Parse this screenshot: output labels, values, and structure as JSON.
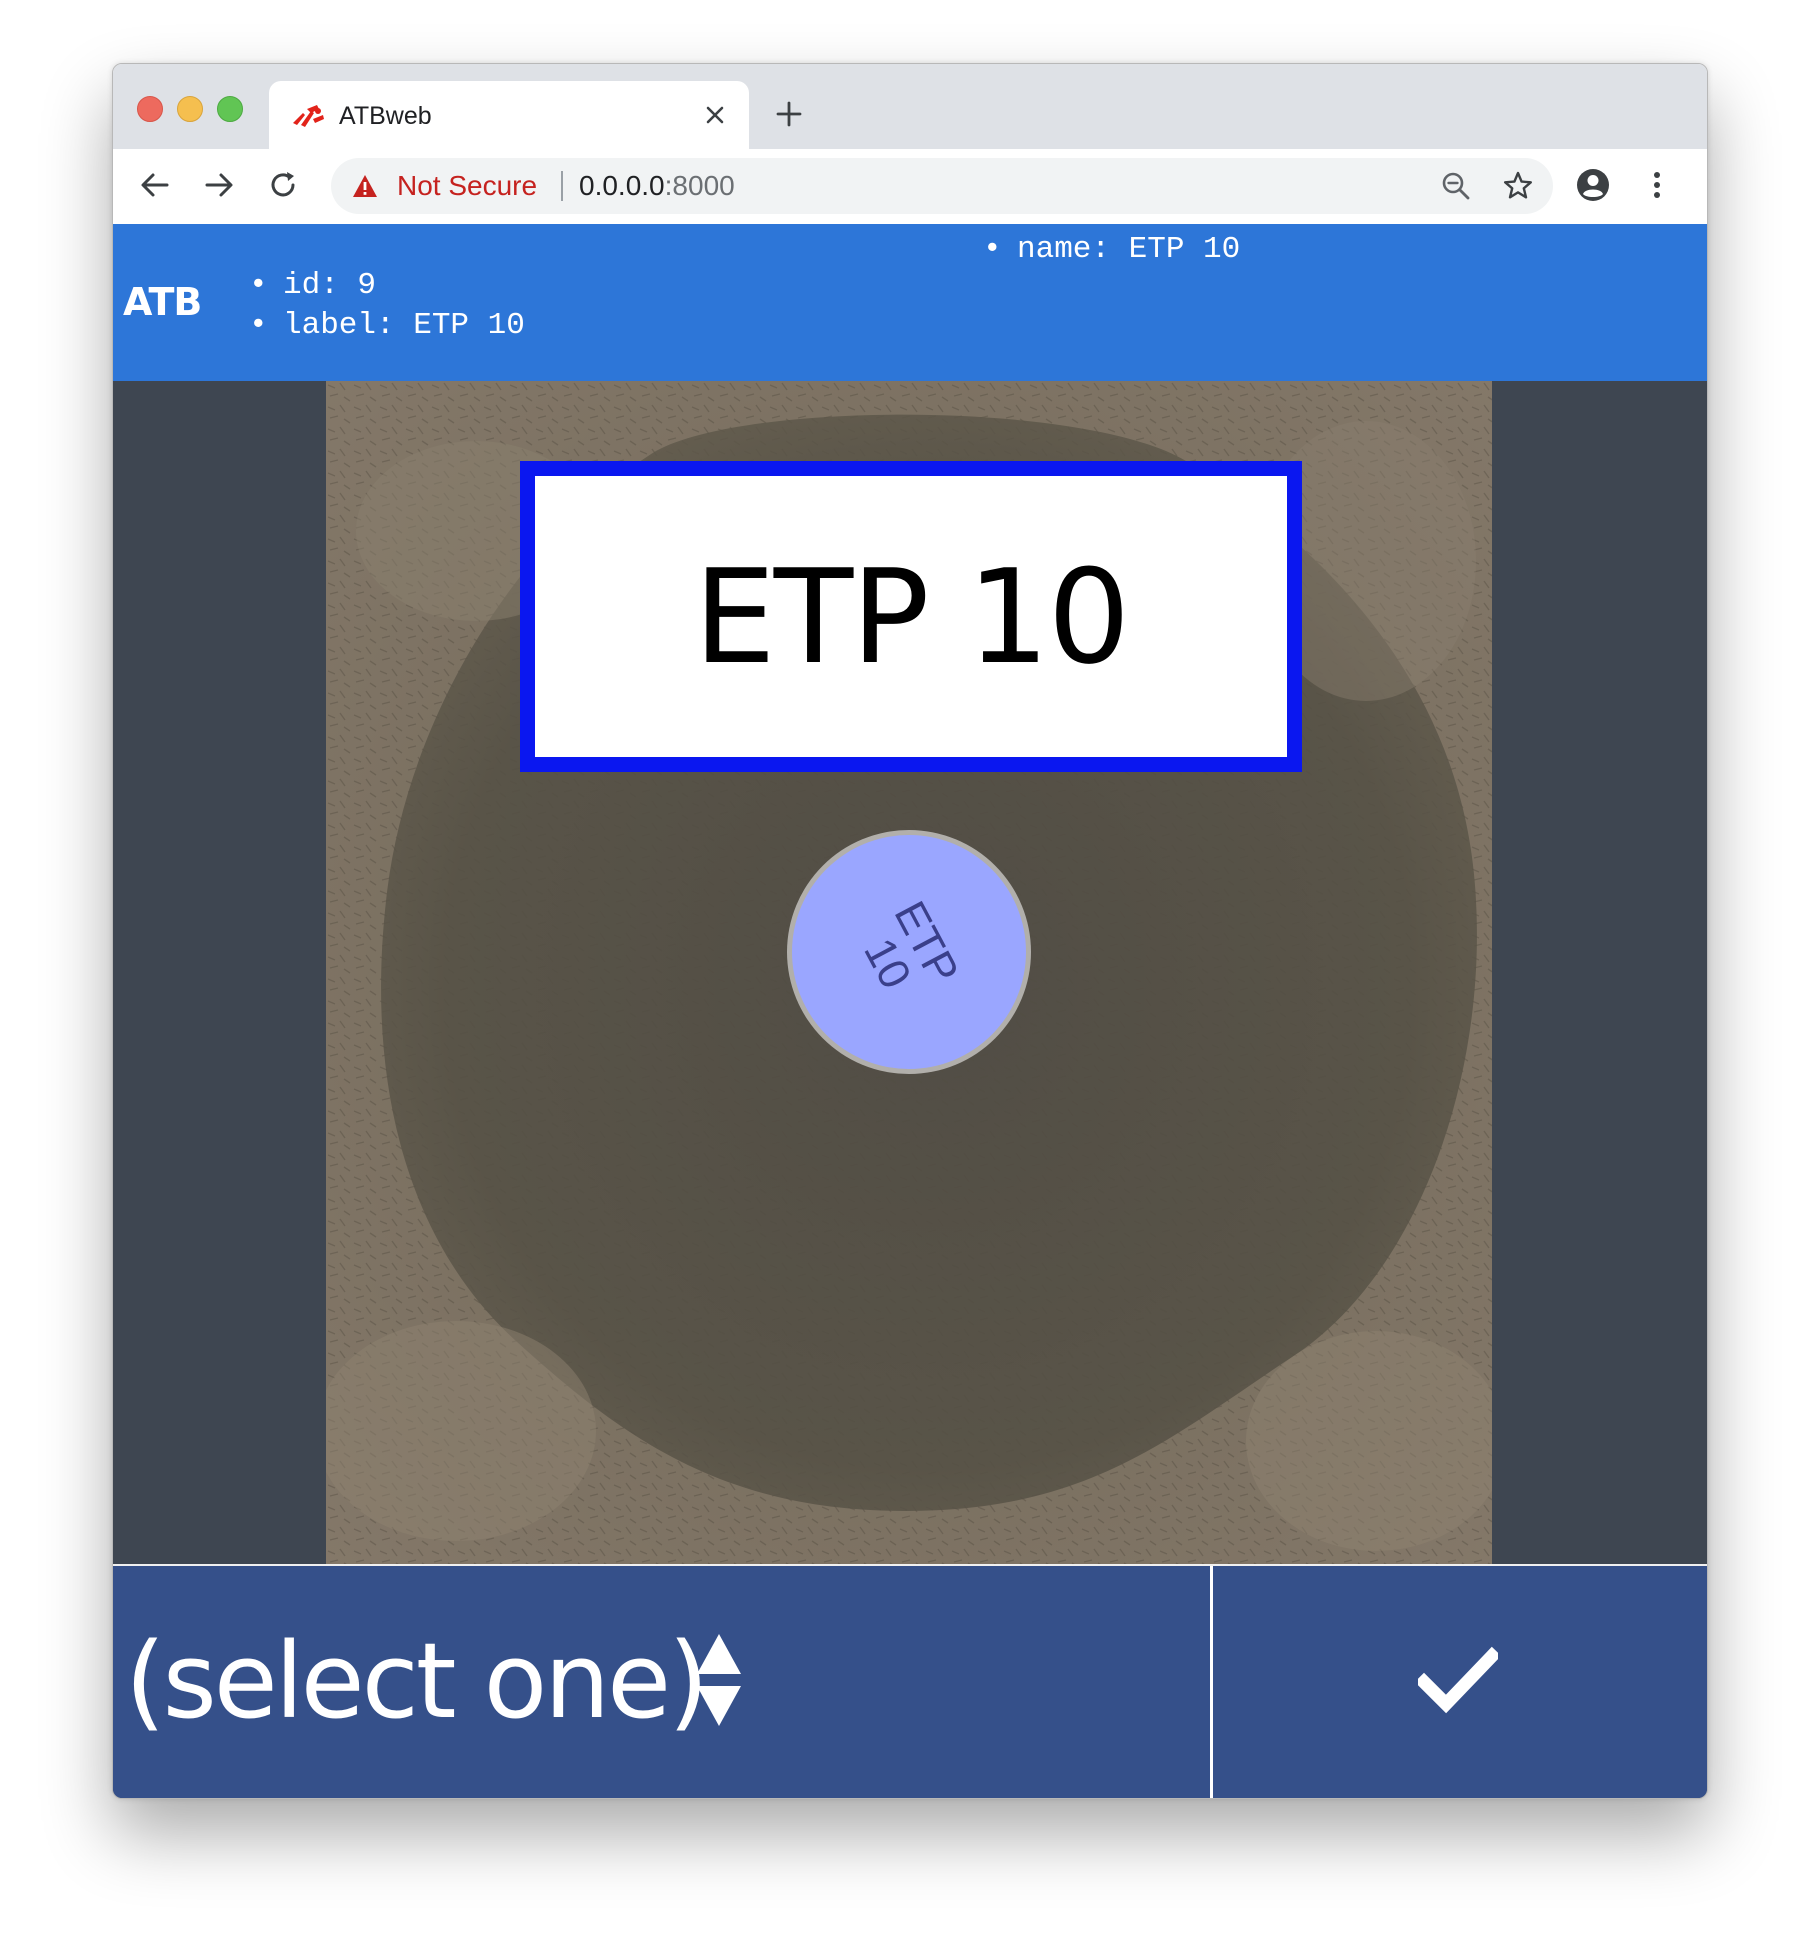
{
  "browser": {
    "tab": {
      "title": "ATBweb",
      "favicon": "msf-logo-icon"
    },
    "toolbar": {
      "security_label": "Not Secure",
      "url_host": "0.0.0.0",
      "url_port": ":8000"
    }
  },
  "header": {
    "brand": "ATB",
    "color": "#2d76d8",
    "meta_left": [
      {
        "text": "id: 9"
      },
      {
        "text": "label: ETP 10"
      }
    ],
    "meta_right": [
      {
        "text": "name: ETP 10"
      }
    ]
  },
  "viewer": {
    "overlay_label": "ETP 10",
    "overlay_border_color": "#0a17f0",
    "disk_marking_line1": "ETP",
    "disk_marking_line2": "10",
    "disk_highlight_color": "#9aa6ff"
  },
  "footer": {
    "select_value": "(select one)",
    "confirm_icon": "check-icon",
    "background": "#35508a"
  }
}
